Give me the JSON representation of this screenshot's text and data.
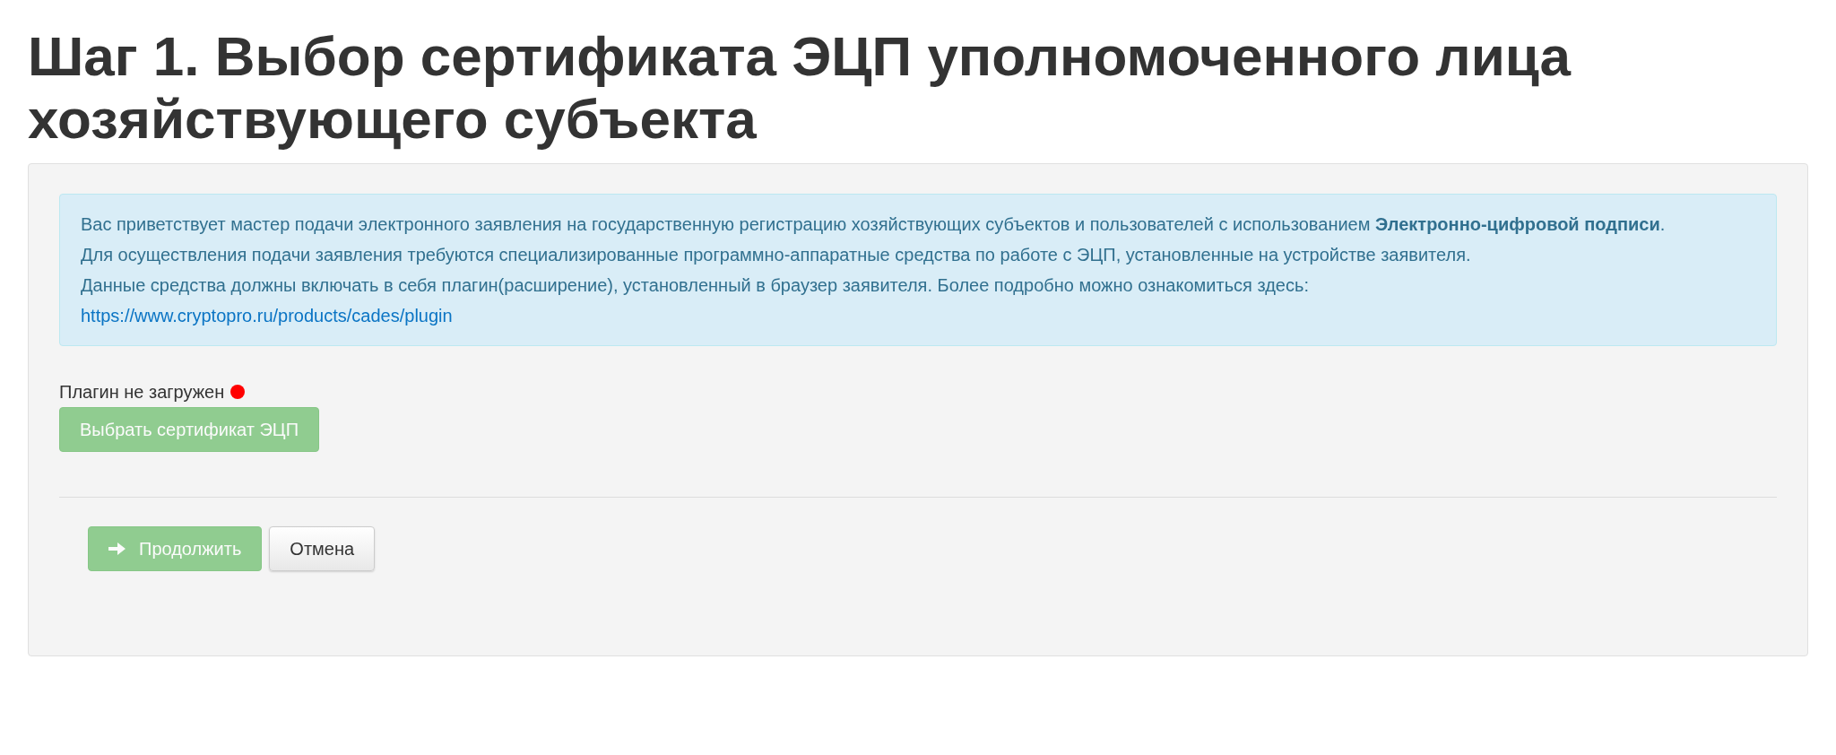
{
  "page_title": "Шаг 1. Выбор сертификата ЭЦП уполномоченного лица хозяйствующего субъекта",
  "alert": {
    "paragraphs": [
      "Вас приветствует мастер подачи электронного заявления на государственную регистрацию хозяйствующих субъектов и пользователей с использованием **Электронно-цифровой подписи**.",
      "Для осуществления подачи заявления требуются специализированные программно-аппаратные средства по работе с ЭЦП, установленные на устройстве заявителя.",
      "Данные средства должны включать в себя плагин(расширение), установленный в браузер заявителя. Более подробно можно ознакомиться здесь:"
    ],
    "link": "https://www.cryptopro.ru/products/cades/plugin"
  },
  "plugin_status": {
    "text": "Плагин не загружен",
    "loaded": false
  },
  "select_button": {
    "label": "Выбрать сертификат ЭЦП",
    "disabled": true
  },
  "actions": [
    {
      "kind": "primary",
      "label": "Продолжить",
      "disabled": true
    },
    {
      "kind": "default",
      "label": "Отмена",
      "disabled": false
    }
  ]
}
